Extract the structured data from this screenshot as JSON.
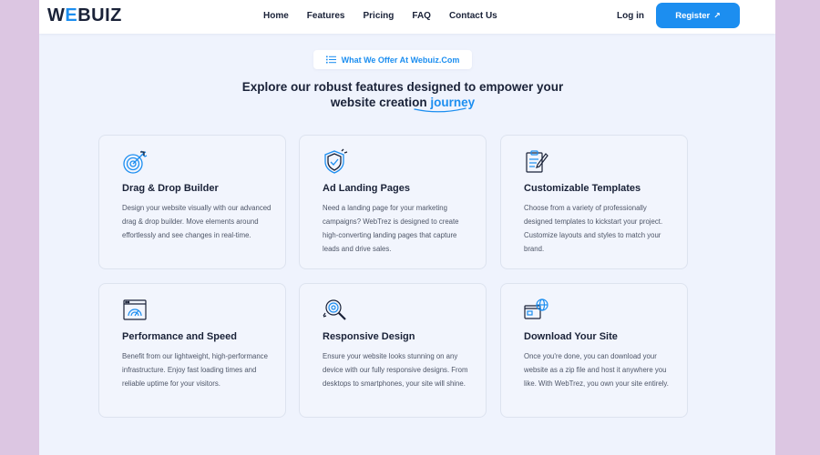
{
  "brand": {
    "logo_prefix": "W",
    "logo_accent": "E",
    "logo_suffix": "BUIZ",
    "accent_color": "#1c8ef0"
  },
  "nav": {
    "links": [
      "Home",
      "Features",
      "Pricing",
      "FAQ",
      "Contact Us"
    ],
    "login": "Log in",
    "register": "Register",
    "register_arrow": "↗"
  },
  "section": {
    "badge": "What We Offer At Webuiz.Com",
    "headline_line1": "Explore our robust features designed to empower your",
    "headline_line2_prefix": "website creation",
    "headline_highlight": "journey"
  },
  "features": [
    {
      "icon": "target-icon",
      "title": "Drag & Drop Builder",
      "description": "Design your website visually with our advanced drag & drop builder. Move elements around effortlessly and see changes in real-time."
    },
    {
      "icon": "shield-check-icon",
      "title": "Ad Landing Pages",
      "description": "Need a landing page for your marketing campaigns? WebTrez is designed to create high-converting landing pages that capture leads and drive sales."
    },
    {
      "icon": "clipboard-pencil-icon",
      "title": "Customizable Templates",
      "description": "Choose from a variety of professionally designed templates to kickstart your project. Customize layouts and styles to match your brand."
    },
    {
      "icon": "speed-gauge-icon",
      "title": "Performance and Speed",
      "description": "Benefit from our lightweight, high-performance infrastructure. Enjoy fast loading times and reliable uptime for your visitors."
    },
    {
      "icon": "magnifier-gear-icon",
      "title": "Responsive Design",
      "description": "Ensure your website looks stunning on any device with our fully responsive designs. From desktops to smartphones, your site will shine."
    },
    {
      "icon": "globe-window-icon",
      "title": "Download Your Site",
      "description": "Once you're done, you can download your website as a zip file and host it anywhere you like. With WebTrez, you own your site entirely."
    }
  ]
}
